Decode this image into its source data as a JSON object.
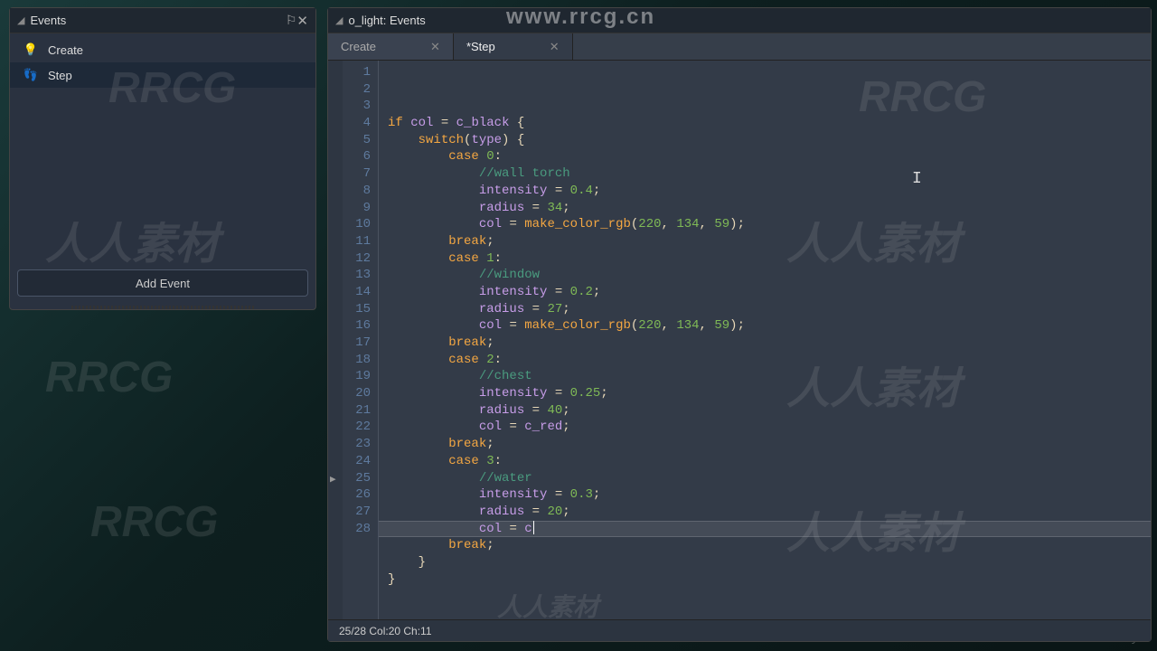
{
  "watermarks": {
    "top": "www.rrcg.cn",
    "rrcg": "RRCG",
    "cn": "人人素材",
    "udemy": "ûdemy"
  },
  "events_panel": {
    "title": "Events",
    "items": [
      {
        "icon": "bulb",
        "label": "Create"
      },
      {
        "icon": "steps",
        "label": "Step"
      }
    ],
    "add_button": "Add Event"
  },
  "editor": {
    "title": "o_light: Events",
    "tabs": [
      {
        "label": "Create",
        "active": false
      },
      {
        "label": "*Step",
        "active": true
      }
    ],
    "status": "25/28 Col:20 Ch:11",
    "cursor_line": 25
  },
  "code_lines": [
    {
      "n": 1,
      "tokens": [
        [
          "kw",
          "if"
        ],
        [
          "op",
          " "
        ],
        [
          "var",
          "col"
        ],
        [
          "op",
          " = "
        ],
        [
          "var",
          "c_black"
        ],
        [
          "op",
          " {"
        ]
      ]
    },
    {
      "n": 2,
      "tokens": [
        [
          "op",
          "    "
        ],
        [
          "kw",
          "switch"
        ],
        [
          "op",
          "("
        ],
        [
          "var",
          "type"
        ],
        [
          "op",
          ") {"
        ]
      ]
    },
    {
      "n": 3,
      "tokens": [
        [
          "op",
          "        "
        ],
        [
          "kw",
          "case"
        ],
        [
          "op",
          " "
        ],
        [
          "num",
          "0"
        ],
        [
          "op",
          ":"
        ]
      ]
    },
    {
      "n": 4,
      "tokens": [
        [
          "op",
          "            "
        ],
        [
          "cmt",
          "//wall torch"
        ]
      ]
    },
    {
      "n": 5,
      "tokens": [
        [
          "op",
          "            "
        ],
        [
          "var",
          "intensity"
        ],
        [
          "op",
          " = "
        ],
        [
          "num",
          "0.4"
        ],
        [
          "op",
          ";"
        ]
      ]
    },
    {
      "n": 6,
      "tokens": [
        [
          "op",
          "            "
        ],
        [
          "var",
          "radius"
        ],
        [
          "op",
          " = "
        ],
        [
          "num",
          "34"
        ],
        [
          "op",
          ";"
        ]
      ]
    },
    {
      "n": 7,
      "tokens": [
        [
          "op",
          "            "
        ],
        [
          "var",
          "col"
        ],
        [
          "op",
          " = "
        ],
        [
          "fn",
          "make_color_rgb"
        ],
        [
          "op",
          "("
        ],
        [
          "num",
          "220"
        ],
        [
          "op",
          ", "
        ],
        [
          "num",
          "134"
        ],
        [
          "op",
          ", "
        ],
        [
          "num",
          "59"
        ],
        [
          "op",
          ");"
        ]
      ]
    },
    {
      "n": 8,
      "tokens": [
        [
          "op",
          "        "
        ],
        [
          "kw",
          "break"
        ],
        [
          "op",
          ";"
        ]
      ]
    },
    {
      "n": 9,
      "tokens": [
        [
          "op",
          "        "
        ],
        [
          "kw",
          "case"
        ],
        [
          "op",
          " "
        ],
        [
          "num",
          "1"
        ],
        [
          "op",
          ":"
        ]
      ]
    },
    {
      "n": 10,
      "tokens": [
        [
          "op",
          "            "
        ],
        [
          "cmt",
          "//window"
        ]
      ]
    },
    {
      "n": 11,
      "tokens": [
        [
          "op",
          "            "
        ],
        [
          "var",
          "intensity"
        ],
        [
          "op",
          " = "
        ],
        [
          "num",
          "0.2"
        ],
        [
          "op",
          ";"
        ]
      ]
    },
    {
      "n": 12,
      "tokens": [
        [
          "op",
          "            "
        ],
        [
          "var",
          "radius"
        ],
        [
          "op",
          " = "
        ],
        [
          "num",
          "27"
        ],
        [
          "op",
          ";"
        ]
      ]
    },
    {
      "n": 13,
      "tokens": [
        [
          "op",
          "            "
        ],
        [
          "var",
          "col"
        ],
        [
          "op",
          " = "
        ],
        [
          "fn",
          "make_color_rgb"
        ],
        [
          "op",
          "("
        ],
        [
          "num",
          "220"
        ],
        [
          "op",
          ", "
        ],
        [
          "num",
          "134"
        ],
        [
          "op",
          ", "
        ],
        [
          "num",
          "59"
        ],
        [
          "op",
          ");"
        ]
      ]
    },
    {
      "n": 14,
      "tokens": [
        [
          "op",
          "        "
        ],
        [
          "kw",
          "break"
        ],
        [
          "op",
          ";"
        ]
      ]
    },
    {
      "n": 15,
      "tokens": [
        [
          "op",
          "        "
        ],
        [
          "kw",
          "case"
        ],
        [
          "op",
          " "
        ],
        [
          "num",
          "2"
        ],
        [
          "op",
          ":"
        ]
      ]
    },
    {
      "n": 16,
      "tokens": [
        [
          "op",
          "            "
        ],
        [
          "cmt",
          "//chest"
        ]
      ]
    },
    {
      "n": 17,
      "tokens": [
        [
          "op",
          "            "
        ],
        [
          "var",
          "intensity"
        ],
        [
          "op",
          " = "
        ],
        [
          "num",
          "0.25"
        ],
        [
          "op",
          ";"
        ]
      ]
    },
    {
      "n": 18,
      "tokens": [
        [
          "op",
          "            "
        ],
        [
          "var",
          "radius"
        ],
        [
          "op",
          " = "
        ],
        [
          "num",
          "40"
        ],
        [
          "op",
          ";"
        ]
      ]
    },
    {
      "n": 19,
      "tokens": [
        [
          "op",
          "            "
        ],
        [
          "var",
          "col"
        ],
        [
          "op",
          " = "
        ],
        [
          "var",
          "c_red"
        ],
        [
          "op",
          ";"
        ]
      ]
    },
    {
      "n": 20,
      "tokens": [
        [
          "op",
          "        "
        ],
        [
          "kw",
          "break"
        ],
        [
          "op",
          ";"
        ]
      ]
    },
    {
      "n": 21,
      "tokens": [
        [
          "op",
          "        "
        ],
        [
          "kw",
          "case"
        ],
        [
          "op",
          " "
        ],
        [
          "num",
          "3"
        ],
        [
          "op",
          ":"
        ]
      ]
    },
    {
      "n": 22,
      "tokens": [
        [
          "op",
          "            "
        ],
        [
          "cmt",
          "//water"
        ]
      ]
    },
    {
      "n": 23,
      "tokens": [
        [
          "op",
          "            "
        ],
        [
          "var",
          "intensity"
        ],
        [
          "op",
          " = "
        ],
        [
          "num",
          "0.3"
        ],
        [
          "op",
          ";"
        ]
      ]
    },
    {
      "n": 24,
      "tokens": [
        [
          "op",
          "            "
        ],
        [
          "var",
          "radius"
        ],
        [
          "op",
          " = "
        ],
        [
          "num",
          "20"
        ],
        [
          "op",
          ";"
        ]
      ]
    },
    {
      "n": 25,
      "tokens": [
        [
          "op",
          "            "
        ],
        [
          "var",
          "col"
        ],
        [
          "op",
          " = "
        ],
        [
          "var",
          "c"
        ]
      ],
      "current": true,
      "caret": true
    },
    {
      "n": 26,
      "tokens": [
        [
          "op",
          "        "
        ],
        [
          "kw",
          "break"
        ],
        [
          "op",
          ";"
        ]
      ]
    },
    {
      "n": 27,
      "tokens": [
        [
          "op",
          "    }"
        ]
      ]
    },
    {
      "n": 28,
      "tokens": [
        [
          "op",
          "}"
        ]
      ]
    }
  ]
}
